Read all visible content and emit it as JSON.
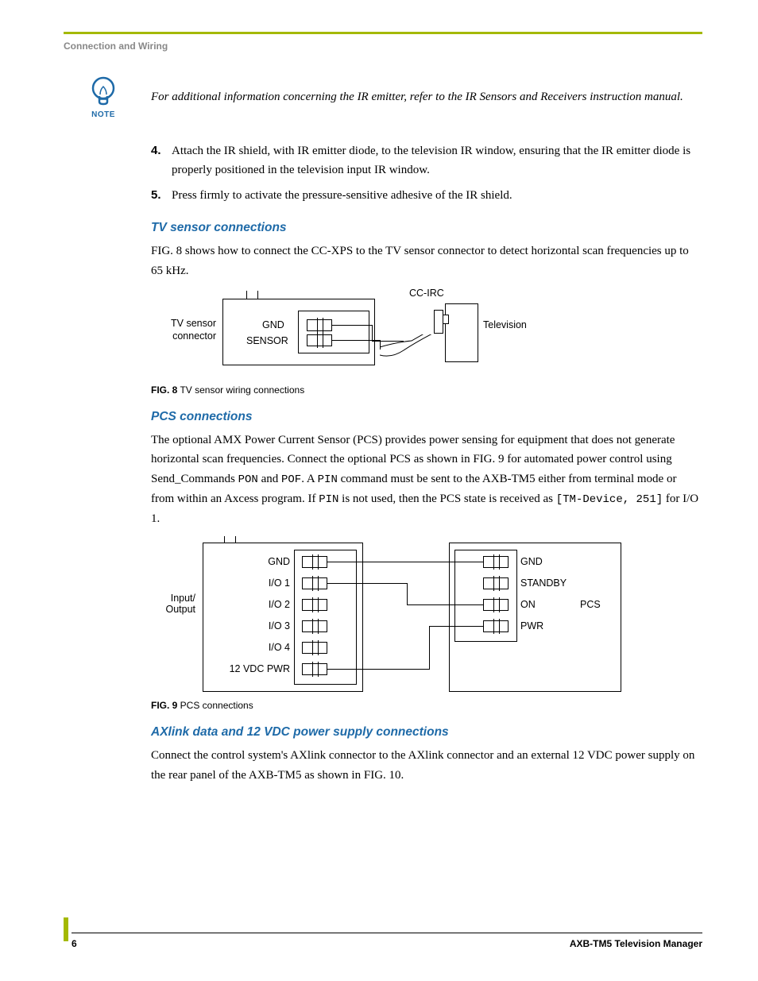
{
  "header": {
    "section": "Connection and Wiring"
  },
  "note": {
    "label": "NOTE",
    "text": "For additional information concerning the IR emitter, refer to the IR Sensors and Receivers instruction manual."
  },
  "steps": [
    {
      "num": "4.",
      "text": "Attach the IR shield, with IR emitter diode, to the television IR window, ensuring that the IR emitter diode is properly positioned in the television input IR window."
    },
    {
      "num": "5.",
      "text": "Press firmly to activate the pressure-sensitive adhesive of the IR shield."
    }
  ],
  "section_tv": {
    "title": "TV sensor connections",
    "para": "FIG. 8 shows how to connect the CC-XPS to the TV sensor connector to detect horizontal scan frequencies up to 65 kHz."
  },
  "fig8": {
    "caption_bold": "FIG. 8",
    "caption_rest": "  TV sensor wiring connections",
    "labels": {
      "tv_sensor_1": "TV sensor",
      "tv_sensor_2": "connector",
      "gnd": "GND",
      "sensor": "SENSOR",
      "ccirc": "CC-IRC",
      "television": "Television"
    }
  },
  "section_pcs": {
    "title": "PCS connections",
    "para_pre": "The optional AMX Power Current Sensor (PCS) provides power sensing for equipment that does not generate horizontal scan frequencies. Connect the optional PCS as shown in FIG. 9 for automated power control using Send_Commands ",
    "code1": "PON",
    "mid1": " and ",
    "code2": "POF",
    "mid2": ". A ",
    "code3": "PIN",
    "mid3": " command must be sent to the AXB-TM5 either from terminal mode or from within an Axcess program. If ",
    "code4": "PIN",
    "mid4": " is not used, then the PCS state is received as ",
    "code5": "[TM-Device, 251]",
    "mid5": " for I/O 1."
  },
  "fig9": {
    "caption_bold": "FIG. 9",
    "caption_rest": "  PCS connections",
    "left_group": "Input/\nOutput",
    "left_labels": [
      "GND",
      "I/O 1",
      "I/O 2",
      "I/O 3",
      "I/O 4",
      "12 VDC PWR"
    ],
    "right_labels": [
      "GND",
      "STANDBY",
      "ON",
      "PWR"
    ],
    "right_group": "PCS"
  },
  "section_ax": {
    "title": "AXlink data and 12 VDC power supply connections",
    "para": "Connect the control system's AXlink connector to the AXlink connector and an external 12 VDC power supply on the rear panel of the AXB-TM5 as shown in FIG. 10."
  },
  "footer": {
    "page": "6",
    "doc": "AXB-TM5 Television Manager"
  }
}
